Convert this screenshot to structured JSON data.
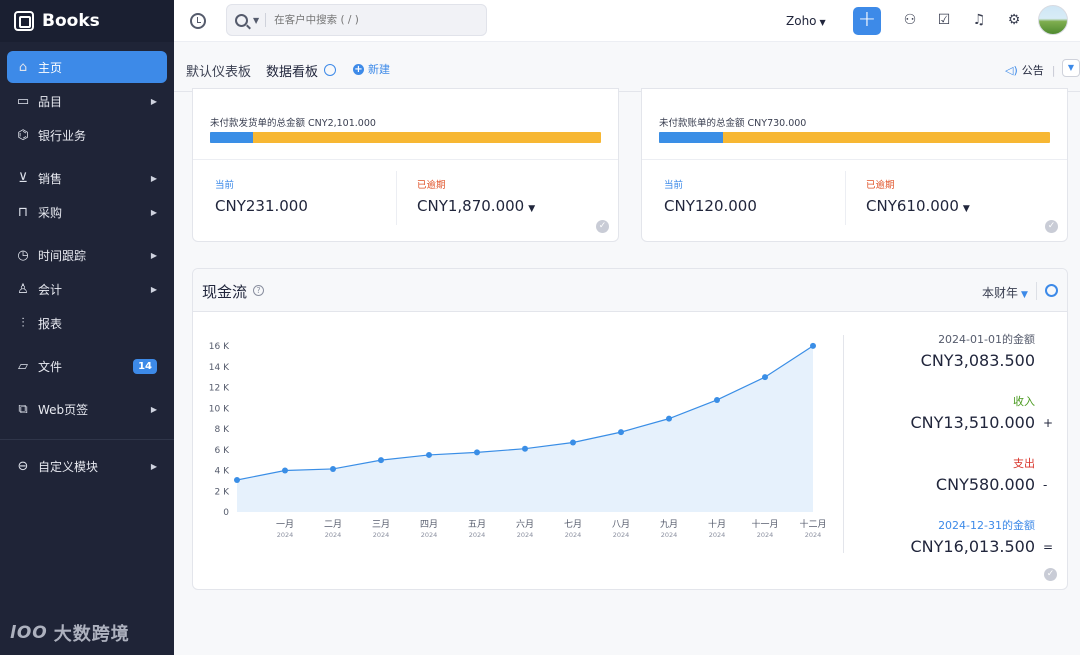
{
  "app": {
    "name": "Books",
    "watermark": "大数跨境"
  },
  "sidebar": {
    "items": [
      {
        "label": "主页",
        "icon": "home-icon",
        "active": true,
        "arrow": false
      },
      {
        "label": "品目",
        "icon": "bag-icon",
        "arrow": true
      },
      {
        "label": "银行业务",
        "icon": "bank-icon",
        "arrow": false
      },
      {
        "label": "销售",
        "icon": "cart-icon",
        "arrow": true
      },
      {
        "label": "采购",
        "icon": "basket-icon",
        "arrow": true
      },
      {
        "label": "时间跟踪",
        "icon": "clock-icon",
        "arrow": true
      },
      {
        "label": "会计",
        "icon": "users-icon",
        "arrow": true
      },
      {
        "label": "报表",
        "icon": "report-icon",
        "arrow": false
      },
      {
        "label": "文件",
        "icon": "folder-icon",
        "arrow": false,
        "badge": "14"
      },
      {
        "label": "Web页签",
        "icon": "tabs-icon",
        "arrow": true
      },
      {
        "label": "自定义模块",
        "icon": "module-icon",
        "arrow": true
      }
    ]
  },
  "topbar": {
    "search_placeholder": "在客户中搜索 ( / )",
    "org": "Zoho",
    "add_label": "+"
  },
  "tabs": {
    "default_dashboard": "默认仪表板",
    "data_board": "数据看板",
    "new_label": "新建",
    "announcement": "公告"
  },
  "receivables": {
    "label": "未付款发货单的总金额 CNY2,101.000",
    "current_label": "当前",
    "current_amount": "CNY231.000",
    "overdue_label": "已逾期",
    "overdue_amount": "CNY1,870.000",
    "current_fraction": 0.11
  },
  "payables": {
    "label": "未付款账单的总金额 CNY730.000",
    "current_label": "当前",
    "current_amount": "CNY120.000",
    "overdue_label": "已逾期",
    "overdue_amount": "CNY610.000",
    "current_fraction": 0.164
  },
  "cashflow": {
    "title": "现金流",
    "period": "本财年",
    "opening_label": "2024-01-01的金额",
    "opening_amount": "CNY3,083.500",
    "income_label": "收入",
    "income_amount": "CNY13,510.000",
    "income_op": "+",
    "expense_label": "支出",
    "expense_amount": "CNY580.000",
    "expense_op": "-",
    "closing_label": "2024-12-31的金额",
    "closing_amount": "CNY16,013.500",
    "closing_op": "=",
    "colors": {
      "income": "#4a9a1f",
      "expense": "#d9342b",
      "closing": "#3d8ae8",
      "line": "#3a8ee6",
      "area": "#e6f1fc"
    }
  },
  "chart_data": {
    "type": "area",
    "x": [
      "",
      "一月",
      "二月",
      "三月",
      "四月",
      "五月",
      "六月",
      "七月",
      "八月",
      "九月",
      "十月",
      "十一月",
      "十二月"
    ],
    "x_sub": [
      "",
      "2024",
      "2024",
      "2024",
      "2024",
      "2024",
      "2024",
      "2024",
      "2024",
      "2024",
      "2024",
      "2024",
      "2024"
    ],
    "values": [
      3084,
      4000,
      4150,
      5000,
      5500,
      5750,
      6100,
      6700,
      7700,
      9000,
      10800,
      13000,
      16013
    ],
    "yticks": [
      0,
      2000,
      4000,
      6000,
      8000,
      10000,
      12000,
      14000,
      16000
    ],
    "ytick_labels": [
      "0",
      "2 K",
      "4 K",
      "6 K",
      "8 K",
      "10 K",
      "12 K",
      "14 K",
      "16 K"
    ],
    "ylim": [
      0,
      16000
    ],
    "grid": false
  }
}
